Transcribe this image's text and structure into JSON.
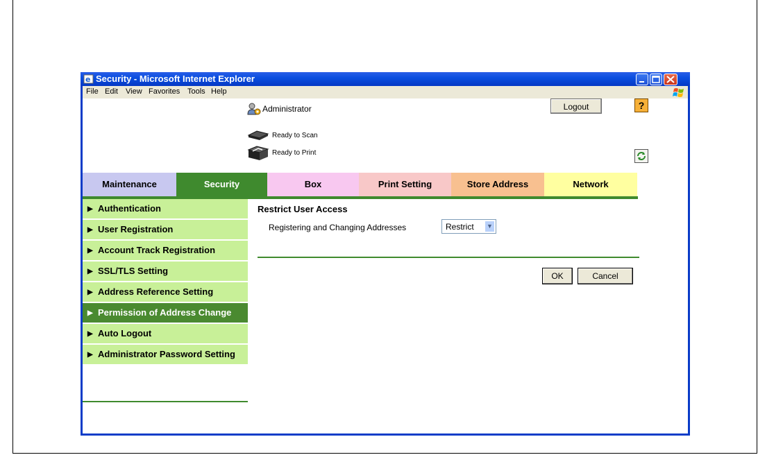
{
  "window": {
    "title": "Security - Microsoft Internet Explorer"
  },
  "menu": [
    "File",
    "Edit",
    "View",
    "Favorites",
    "Tools",
    "Help"
  ],
  "header": {
    "user": "Administrator",
    "logout": "Logout",
    "help": "?",
    "status_scan": "Ready to Scan",
    "status_print": "Ready to Print"
  },
  "tabs": {
    "maintenance": "Maintenance",
    "security": "Security",
    "box": "Box",
    "print_setting": "Print Setting",
    "store_address": "Store Address",
    "network": "Network"
  },
  "sidebar": {
    "items": [
      "Authentication",
      "User Registration",
      "Account Track Registration",
      "SSL/TLS Setting",
      "Address Reference Setting",
      "Permission of Address Change",
      "Auto Logout",
      "Administrator Password Setting"
    ],
    "active_index": 5
  },
  "main": {
    "title": "Restrict User Access",
    "field_label": "Registering and Changing Addresses",
    "field_value": "Restrict",
    "ok": "OK",
    "cancel": "Cancel"
  }
}
